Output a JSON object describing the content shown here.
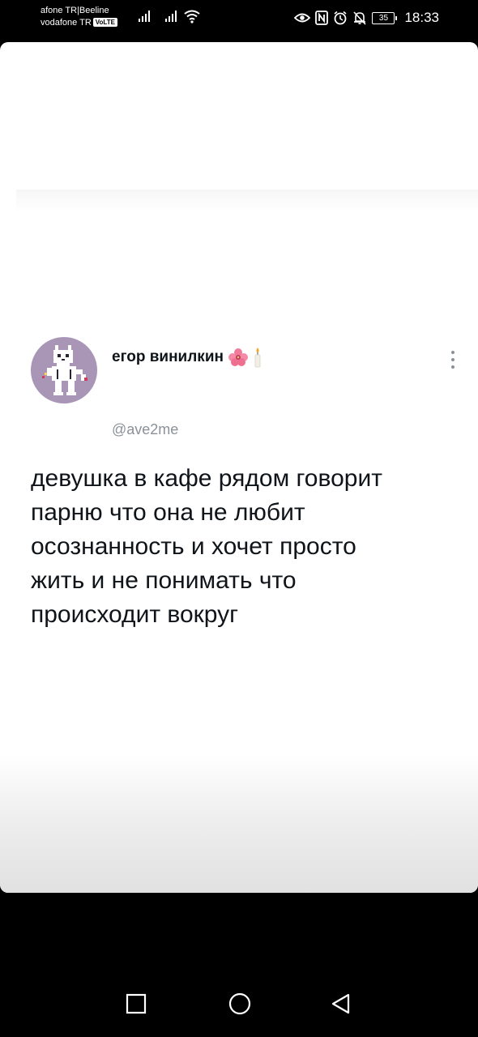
{
  "status_bar": {
    "carrier_line1": "afone TR|Beeline",
    "carrier_line2": "vodafone TR",
    "volte_badge": "VoLTE",
    "battery_level": "35",
    "time": "18:33",
    "icons": [
      "signal-icon",
      "signal-icon",
      "wifi-icon",
      "eye-icon",
      "nfc-icon",
      "alarm-icon",
      "mute-bell-icon",
      "battery-icon"
    ]
  },
  "tweet": {
    "display_name": "егор винилкин",
    "name_emojis": [
      "hibiscus-icon",
      "candle-icon"
    ],
    "handle": "@ave2me",
    "text": "девушка в кафе рядом говорит\nпарню что она не любит\nосознанность и хочет просто\nжить и не понимать что\nпроисходит вокруг"
  },
  "nav_bar": {
    "buttons": [
      "recents-button",
      "home-button",
      "back-button"
    ]
  },
  "colors": {
    "background": "#000000",
    "card": "#ffffff",
    "avatar_bg": "#a996b7",
    "text": "#0f1419",
    "handle": "#8a9199"
  }
}
